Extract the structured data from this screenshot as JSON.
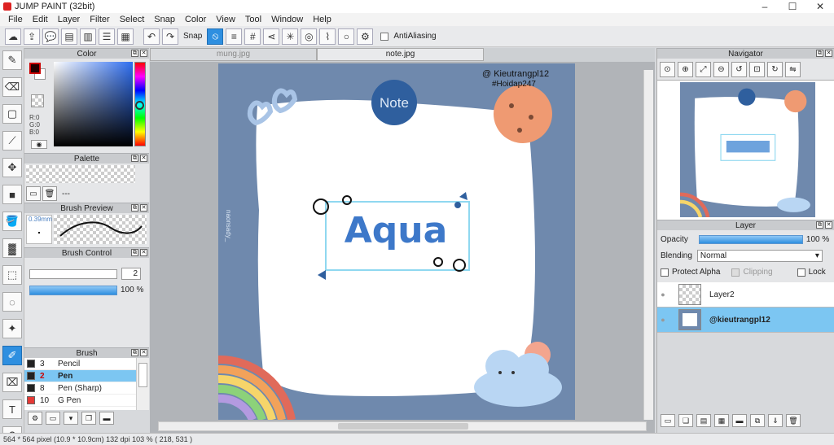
{
  "window": {
    "title": "JUMP PAINT (32bit)",
    "min": "–",
    "max": "☐",
    "close": "✕"
  },
  "menu": [
    "File",
    "Edit",
    "Layer",
    "Filter",
    "Select",
    "Snap",
    "Color",
    "View",
    "Tool",
    "Window",
    "Help"
  ],
  "toolbar": {
    "snap_label": "Snap",
    "antialias_label": "AntiAliasing"
  },
  "tabs": [
    {
      "label": "mung.jpg"
    },
    {
      "label": "note.jpg"
    }
  ],
  "panels": {
    "color": {
      "title": "Color",
      "r": "R:0",
      "g": "G:0",
      "b": "B:0",
      "fg_color": "#220000",
      "bg_color": "#ffffff"
    },
    "palette": {
      "title": "Palette",
      "text": "---"
    },
    "brush_preview": {
      "title": "Brush Preview",
      "size": "0.39mm"
    },
    "brush_control": {
      "title": "Brush Control",
      "size_value": "2",
      "opacity_value": "100 %"
    },
    "brush": {
      "title": "Brush",
      "items": [
        {
          "num": "3",
          "name": "Pencil",
          "color": "#222222"
        },
        {
          "num": "2",
          "name": "Pen",
          "color": "#222222"
        },
        {
          "num": "8",
          "name": "Pen (Sharp)",
          "color": "#222222"
        },
        {
          "num": "10",
          "name": "G Pen",
          "color": "#e53935"
        }
      ],
      "selected_index": 1
    },
    "navigator": {
      "title": "Navigator"
    },
    "layer": {
      "title": "Layer",
      "opacity_label": "Opacity",
      "opacity_value": "100 %",
      "blending_label": "Blending",
      "blending_value": "Normal",
      "protect_alpha": "Protect Alpha",
      "clipping": "Clipping",
      "lock": "Lock",
      "layers": [
        {
          "name": "Layer2"
        },
        {
          "name": "@kieutrangpl12"
        }
      ],
      "selected_index": 1
    }
  },
  "canvas": {
    "watermark": "@ Kieutrangpl12",
    "hashtag": "#Hoidap247",
    "note_text": "Note",
    "title_text": "Aqua",
    "side_text": "naonsady_",
    "bg_color": "#6f89ad"
  },
  "status": {
    "text": "564 * 564 pixel   (10.9 * 10.9cm)   132 dpi   103 %   ( 218, 531 )"
  }
}
